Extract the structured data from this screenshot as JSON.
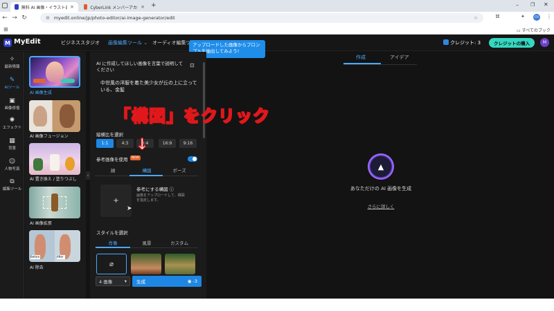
{
  "browser": {
    "tabs": [
      {
        "title": "無料 AI 画像・イラスト自動生成ツ",
        "close": "×",
        "active": true
      },
      {
        "title": "CyberLink メンバーアカウント認証・",
        "close": "×",
        "active": false
      }
    ],
    "new_tab": "+",
    "url": "myedit.online/jp/photo-editor/ai-image-generator/edit",
    "bookmarks_label": "すべてのブックマーク",
    "profile_initial": "CR"
  },
  "app": {
    "logo": "MyEdit",
    "nav": [
      "ビジネススタジオ",
      "画像編集ツール",
      "オーディオ編集ツ"
    ],
    "tooltip": "アップロードした画像からプロンプトを抽出してみよう!",
    "credit": "クレジット: 3",
    "buy_button": "クレジットの購入",
    "avatar_initial": "M"
  },
  "rail": [
    {
      "label": "最新情報",
      "icon": "sparkle-icon"
    },
    {
      "label": "AIツール",
      "icon": "ai-tools-icon",
      "selected": true
    },
    {
      "label": "画像修復",
      "icon": "image-repair-icon"
    },
    {
      "label": "エフェクト",
      "icon": "effect-icon"
    },
    {
      "label": "背景",
      "icon": "background-icon"
    },
    {
      "label": "人物写真",
      "icon": "portrait-icon"
    },
    {
      "label": "編集ツール",
      "icon": "edit-tools-icon"
    }
  ],
  "tools": [
    {
      "label": "AI 画像生成",
      "selected": true
    },
    {
      "label": "AI 画像フュージョン"
    },
    {
      "label": "AI 置き換え / 塗りつぶし"
    },
    {
      "label": "AI 画像拡張"
    },
    {
      "label": "AI 除去"
    }
  ],
  "panel": {
    "prompt_label": "AI に作成してほしい画像を言葉で説明してください",
    "prompt_value": "中世風の洋服を着た美少女が丘の上に立っている、金髪",
    "aspect_label": "縦横比を選択",
    "ratios": [
      "1:1",
      "4:3",
      "3:4",
      "16:9",
      "9:16"
    ],
    "reference_label": "参考画像を使用",
    "new_badge": "NEW",
    "ref_tabs": [
      "顔",
      "構図",
      "ポーズ"
    ],
    "ref_title": "参考にする構図",
    "ref_desc": "画像をアップロードして、構図を指定します。",
    "add_plus": "+",
    "style_label": "スタイルを選択",
    "style_tabs": [
      "肖像",
      "風景",
      "カスタム"
    ],
    "count_value": "4 画像",
    "generate_label": "生成",
    "generate_cost": "-3"
  },
  "annotation": {
    "text": "「構図」をクリック",
    "arrow": "↓"
  },
  "right": {
    "tabs": [
      "作成",
      "アイデア"
    ],
    "empty_title": "あなただけの AI 画像を生成",
    "learn_more": "さらに詳しく"
  },
  "colors": {
    "accent": "#1e87e4",
    "accent_light": "#4aa9ff",
    "buy": "#35d7c1",
    "annotation_red": "#e0181b"
  }
}
